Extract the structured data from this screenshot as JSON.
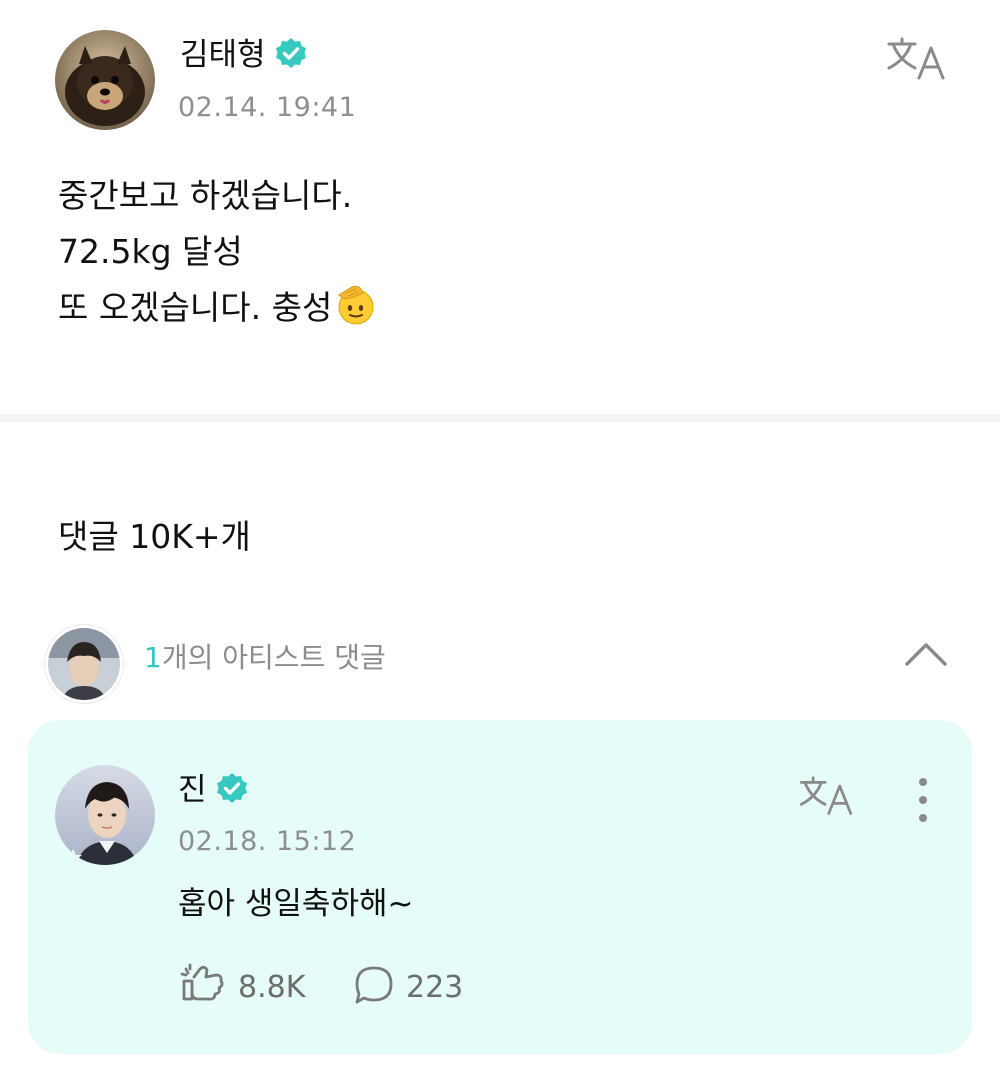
{
  "post": {
    "author": "김태형",
    "timestamp": "02.14. 19:41",
    "lines": [
      "중간보고 하겠습니다.",
      "72.5kg 달성",
      "또 오겠습니다. 충성"
    ],
    "emoji": "saluting-face"
  },
  "comments": {
    "count_label": "댓글 10K+개",
    "artist_count": "1",
    "artist_label": "개의 아티스트 댓글"
  },
  "artist_comment": {
    "author": "진",
    "timestamp": "02.18. 15:12",
    "text": "홉아 생일축하해~",
    "cheers": "8.8K",
    "replies": "223"
  },
  "icons": {
    "verified": "verified-badge-icon",
    "translate": "translate-icon",
    "collapse": "chevron-up-icon",
    "more": "more-vertical-icon",
    "cheer": "cheer-icon",
    "reply": "comment-bubble-icon"
  },
  "colors": {
    "accent": "#37c8c0",
    "card_background": "#e6fcf8",
    "timestamp": "#8f8f8f"
  }
}
